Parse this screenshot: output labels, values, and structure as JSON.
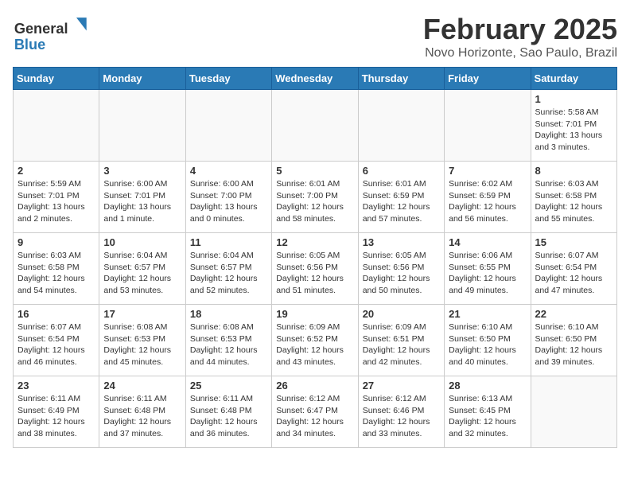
{
  "header": {
    "title": "February 2025",
    "subtitle": "Novo Horizonte, Sao Paulo, Brazil",
    "logo": {
      "general": "General",
      "blue": "Blue"
    }
  },
  "days_of_week": [
    "Sunday",
    "Monday",
    "Tuesday",
    "Wednesday",
    "Thursday",
    "Friday",
    "Saturday"
  ],
  "weeks": [
    [
      {
        "day": "",
        "info": ""
      },
      {
        "day": "",
        "info": ""
      },
      {
        "day": "",
        "info": ""
      },
      {
        "day": "",
        "info": ""
      },
      {
        "day": "",
        "info": ""
      },
      {
        "day": "",
        "info": ""
      },
      {
        "day": "1",
        "info": "Sunrise: 5:58 AM\nSunset: 7:01 PM\nDaylight: 13 hours and 3 minutes."
      }
    ],
    [
      {
        "day": "2",
        "info": "Sunrise: 5:59 AM\nSunset: 7:01 PM\nDaylight: 13 hours and 2 minutes."
      },
      {
        "day": "3",
        "info": "Sunrise: 6:00 AM\nSunset: 7:01 PM\nDaylight: 13 hours and 1 minute."
      },
      {
        "day": "4",
        "info": "Sunrise: 6:00 AM\nSunset: 7:00 PM\nDaylight: 13 hours and 0 minutes."
      },
      {
        "day": "5",
        "info": "Sunrise: 6:01 AM\nSunset: 7:00 PM\nDaylight: 12 hours and 58 minutes."
      },
      {
        "day": "6",
        "info": "Sunrise: 6:01 AM\nSunset: 6:59 PM\nDaylight: 12 hours and 57 minutes."
      },
      {
        "day": "7",
        "info": "Sunrise: 6:02 AM\nSunset: 6:59 PM\nDaylight: 12 hours and 56 minutes."
      },
      {
        "day": "8",
        "info": "Sunrise: 6:03 AM\nSunset: 6:58 PM\nDaylight: 12 hours and 55 minutes."
      }
    ],
    [
      {
        "day": "9",
        "info": "Sunrise: 6:03 AM\nSunset: 6:58 PM\nDaylight: 12 hours and 54 minutes."
      },
      {
        "day": "10",
        "info": "Sunrise: 6:04 AM\nSunset: 6:57 PM\nDaylight: 12 hours and 53 minutes."
      },
      {
        "day": "11",
        "info": "Sunrise: 6:04 AM\nSunset: 6:57 PM\nDaylight: 12 hours and 52 minutes."
      },
      {
        "day": "12",
        "info": "Sunrise: 6:05 AM\nSunset: 6:56 PM\nDaylight: 12 hours and 51 minutes."
      },
      {
        "day": "13",
        "info": "Sunrise: 6:05 AM\nSunset: 6:56 PM\nDaylight: 12 hours and 50 minutes."
      },
      {
        "day": "14",
        "info": "Sunrise: 6:06 AM\nSunset: 6:55 PM\nDaylight: 12 hours and 49 minutes."
      },
      {
        "day": "15",
        "info": "Sunrise: 6:07 AM\nSunset: 6:54 PM\nDaylight: 12 hours and 47 minutes."
      }
    ],
    [
      {
        "day": "16",
        "info": "Sunrise: 6:07 AM\nSunset: 6:54 PM\nDaylight: 12 hours and 46 minutes."
      },
      {
        "day": "17",
        "info": "Sunrise: 6:08 AM\nSunset: 6:53 PM\nDaylight: 12 hours and 45 minutes."
      },
      {
        "day": "18",
        "info": "Sunrise: 6:08 AM\nSunset: 6:53 PM\nDaylight: 12 hours and 44 minutes."
      },
      {
        "day": "19",
        "info": "Sunrise: 6:09 AM\nSunset: 6:52 PM\nDaylight: 12 hours and 43 minutes."
      },
      {
        "day": "20",
        "info": "Sunrise: 6:09 AM\nSunset: 6:51 PM\nDaylight: 12 hours and 42 minutes."
      },
      {
        "day": "21",
        "info": "Sunrise: 6:10 AM\nSunset: 6:50 PM\nDaylight: 12 hours and 40 minutes."
      },
      {
        "day": "22",
        "info": "Sunrise: 6:10 AM\nSunset: 6:50 PM\nDaylight: 12 hours and 39 minutes."
      }
    ],
    [
      {
        "day": "23",
        "info": "Sunrise: 6:11 AM\nSunset: 6:49 PM\nDaylight: 12 hours and 38 minutes."
      },
      {
        "day": "24",
        "info": "Sunrise: 6:11 AM\nSunset: 6:48 PM\nDaylight: 12 hours and 37 minutes."
      },
      {
        "day": "25",
        "info": "Sunrise: 6:11 AM\nSunset: 6:48 PM\nDaylight: 12 hours and 36 minutes."
      },
      {
        "day": "26",
        "info": "Sunrise: 6:12 AM\nSunset: 6:47 PM\nDaylight: 12 hours and 34 minutes."
      },
      {
        "day": "27",
        "info": "Sunrise: 6:12 AM\nSunset: 6:46 PM\nDaylight: 12 hours and 33 minutes."
      },
      {
        "day": "28",
        "info": "Sunrise: 6:13 AM\nSunset: 6:45 PM\nDaylight: 12 hours and 32 minutes."
      },
      {
        "day": "",
        "info": ""
      }
    ]
  ]
}
